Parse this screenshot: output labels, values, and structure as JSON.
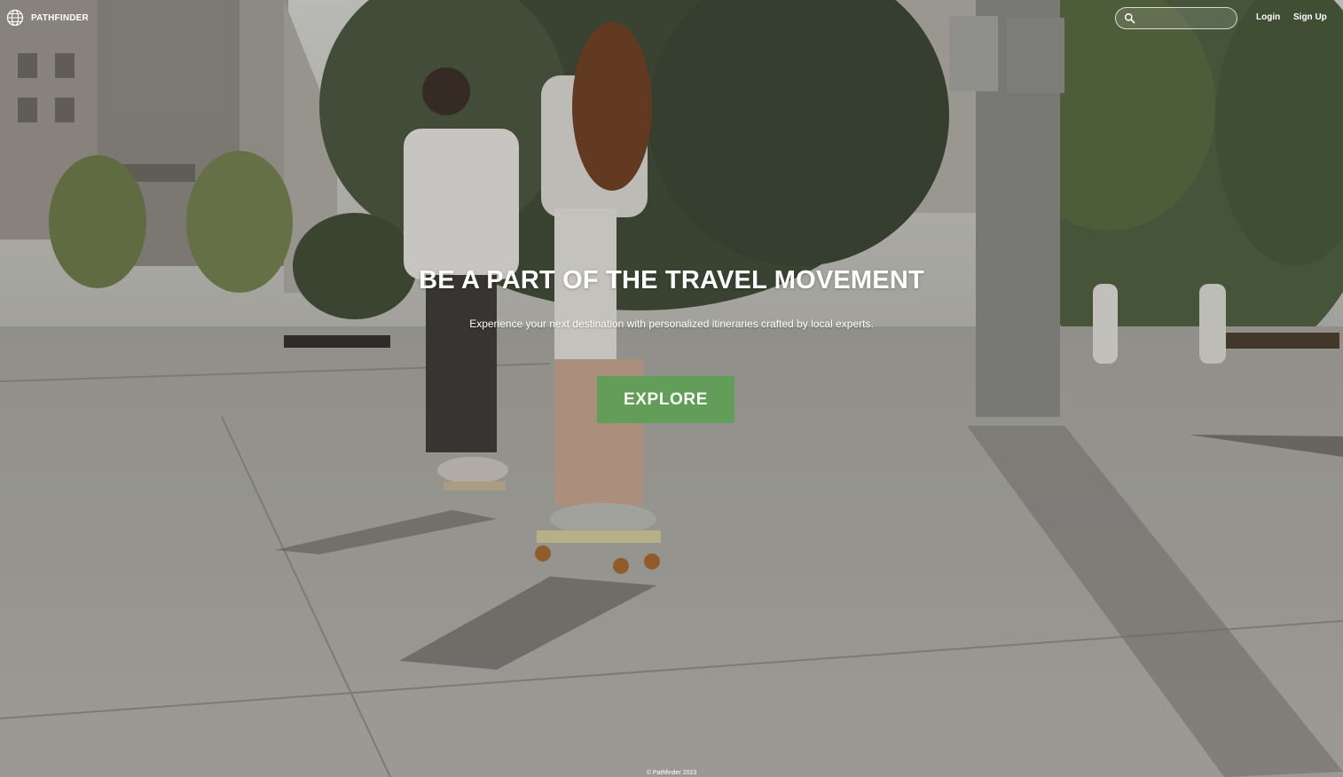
{
  "brand": {
    "name": "PATHFINDER",
    "icon": "globe-icon"
  },
  "nav": {
    "search": {
      "icon": "search-icon",
      "placeholder": "",
      "value": ""
    },
    "login_label": "Login",
    "signup_label": "Sign Up"
  },
  "hero": {
    "title": "BE A PART OF THE TRAVEL MOVEMENT",
    "subtitle": "Experience your next destination with personalized itineraries crafted by local experts.",
    "cta_label": "EXPLORE",
    "cta_color": "#5f9f57"
  },
  "footer": {
    "copyright": "© Pathfinder 2023"
  },
  "background": {
    "description_icon": "photo-background",
    "tint_color": "#8f8c86"
  }
}
